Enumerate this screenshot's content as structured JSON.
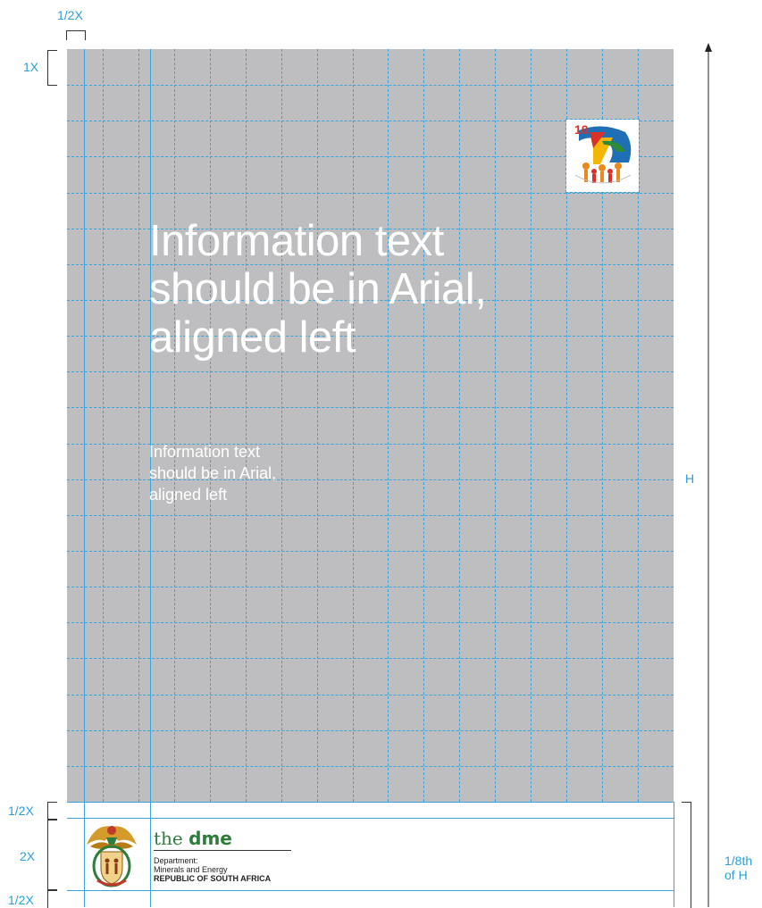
{
  "annotations": {
    "half_x_top": "1/2X",
    "one_x": "1X",
    "height": "H",
    "half_x_footer_top": "1/2X",
    "two_x": "2X",
    "half_x_footer_bottom": "1/2X",
    "eighth_of_h": "1/8th\nof H"
  },
  "poster": {
    "headline": [
      "Information text",
      "should be in Arial,",
      "aligned left"
    ],
    "body": [
      "Information text",
      "should be in Arial,",
      "aligned left"
    ]
  },
  "footer": {
    "brand_prefix": "the",
    "brand_name": "dme",
    "dept_line1": "Department:",
    "dept_line2": "Minerals and Energy",
    "country": "REPUBLIC OF SOUTH AFRICA"
  },
  "colors": {
    "panel": "#bebec0",
    "guide": "#3aa5dc",
    "annotation": "#2a9fd8",
    "brand_green": "#2e7d3a"
  },
  "icons": {
    "anniversary_logo": "ten-years-freedom-logo-icon",
    "coat_of_arms": "south-africa-coat-of-arms-icon"
  }
}
